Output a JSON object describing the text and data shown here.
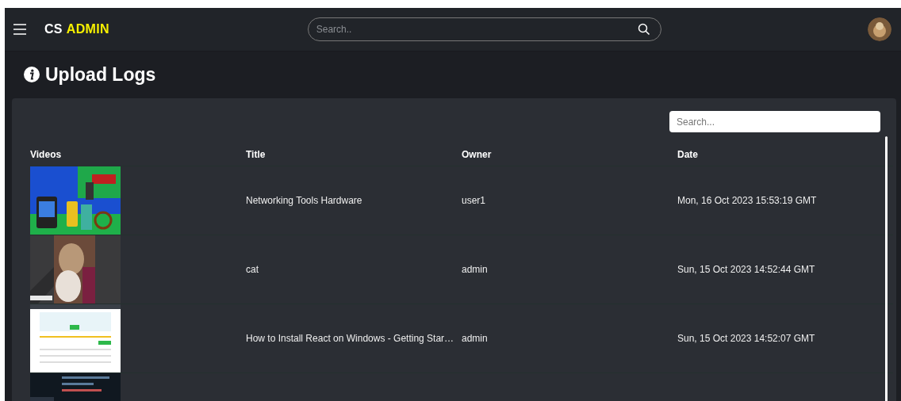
{
  "navbar": {
    "brand": "CS",
    "brand_accent": "ADMIN",
    "search": {
      "placeholder": "Search.."
    }
  },
  "page_title": "Upload Logs",
  "table": {
    "search": {
      "placeholder": "Search..."
    },
    "columns": [
      "Videos",
      "Title",
      "Owner",
      "Date"
    ],
    "rows": [
      {
        "thumbnail": {
          "kind": "picture"
        },
        "title": "Networking Tools Hardware",
        "owner": "user1",
        "date": "Mon, 16 Oct 2023 15:53:19 GMT"
      },
      {
        "thumbnail": {
          "kind": "picture"
        },
        "title": "cat",
        "owner": "admin",
        "date": "Sun, 15 Oct 2023 14:52:44 GMT"
      },
      {
        "thumbnail": {
          "kind": "picture"
        },
        "title": "How to Install React on Windows - Getting Star…",
        "owner": "admin",
        "date": "Sun, 15 Oct 2023 14:52:07 GMT"
      },
      {
        "thumbnail": {
          "kind": "picture"
        }
      }
    ]
  }
}
